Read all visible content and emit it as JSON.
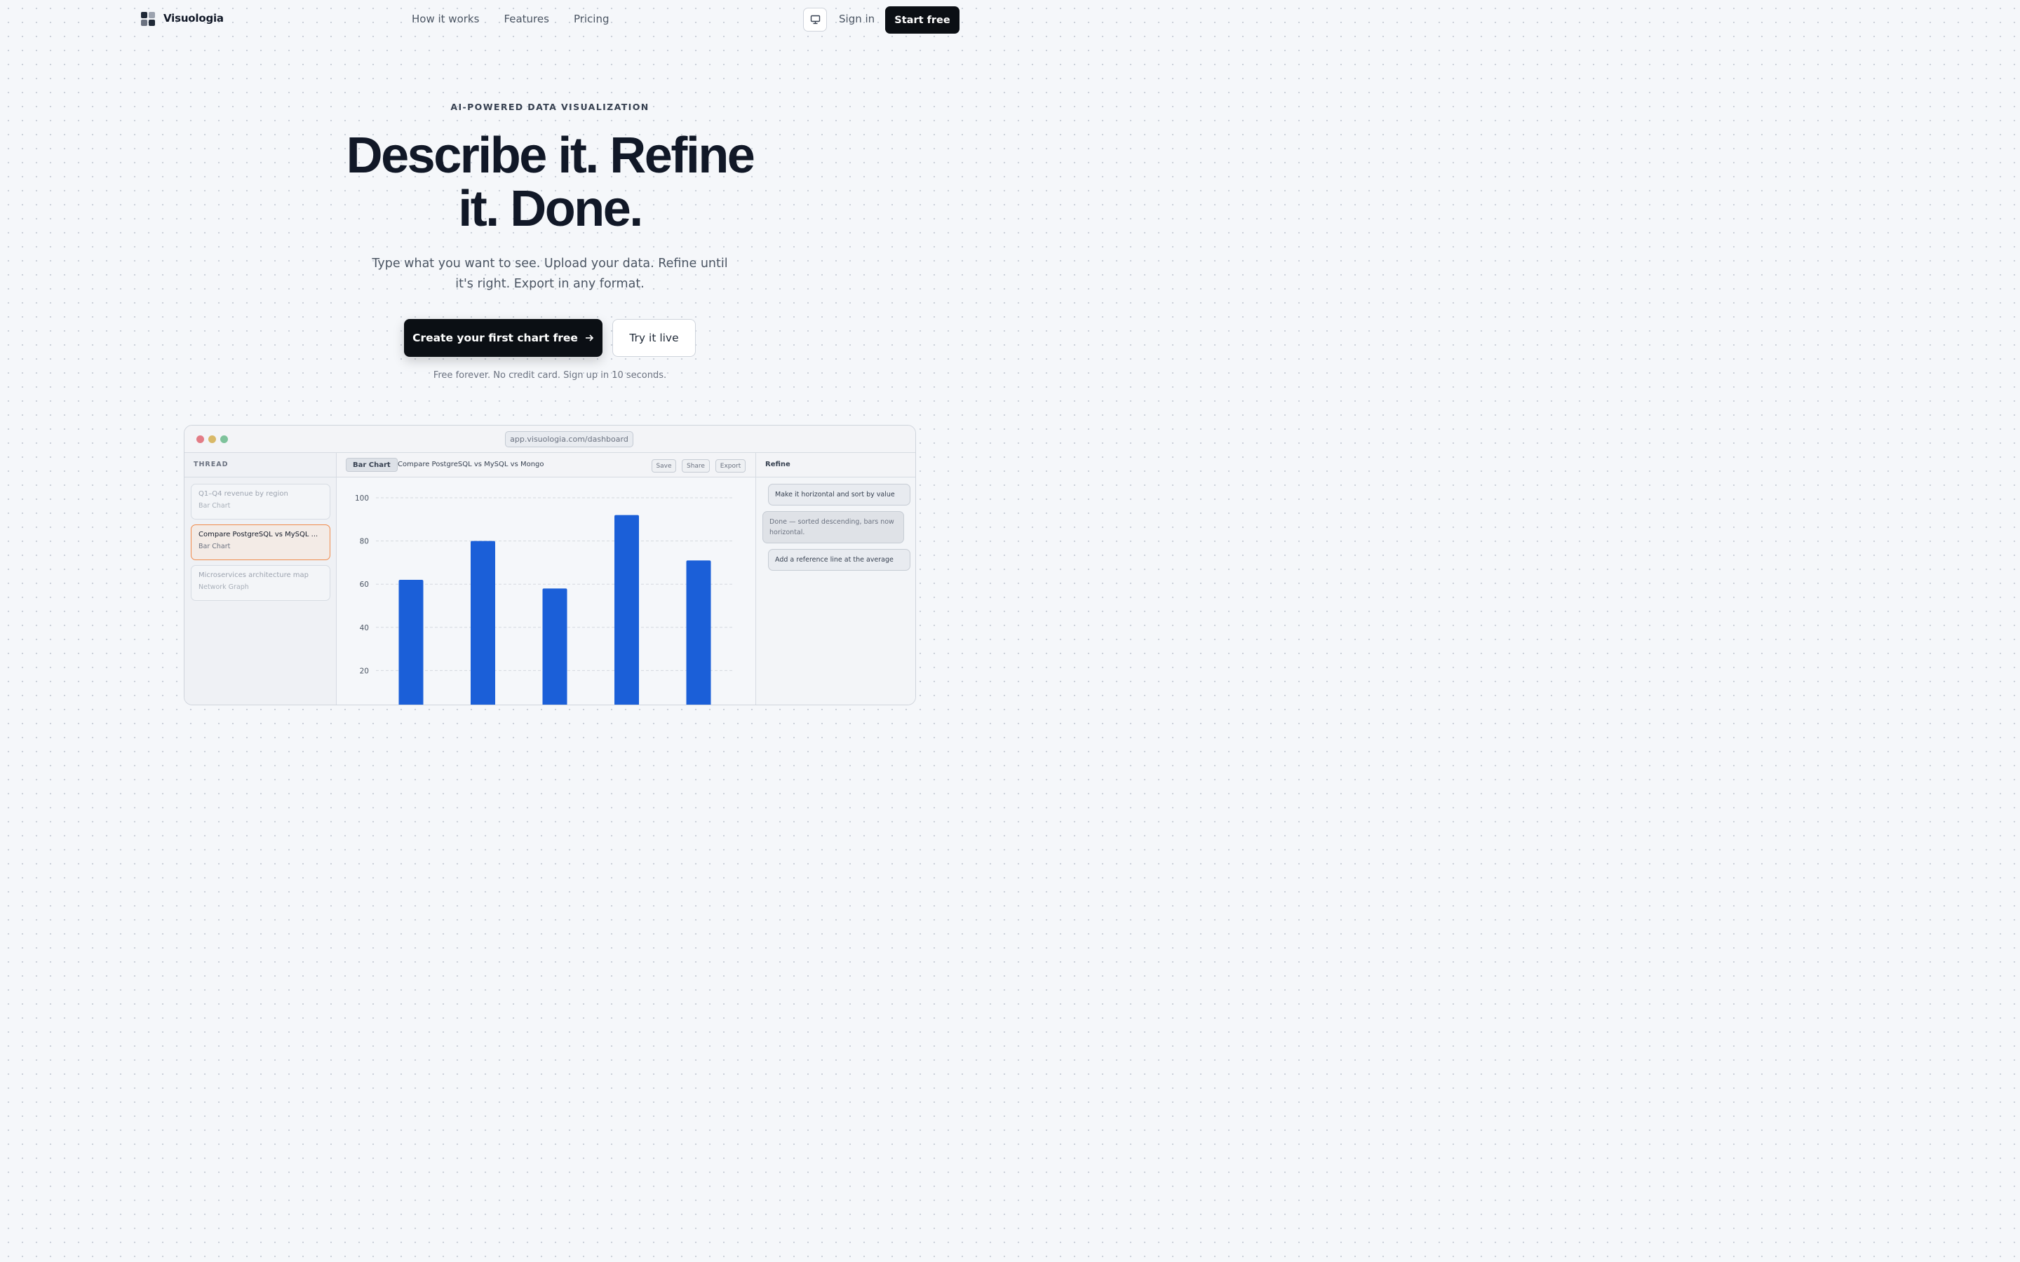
{
  "nav": {
    "brand": "Visuologia",
    "links": [
      "How it works",
      "Features",
      "Pricing"
    ],
    "theme_icon": "monitor-icon",
    "sign_in": "Sign in",
    "start_free": "Start free"
  },
  "hero": {
    "eyebrow": "AI-POWERED DATA VISUALIZATION",
    "headline_line1": "Describe it. Refine",
    "headline_line2": "it. Done.",
    "subhead": "Type what you want to see. Upload your data. Refine until it's right. Export in any format.",
    "cta_primary": "Create your first chart free",
    "cta_secondary": "Try it live",
    "footnote": "Free forever. No credit card. Sign up in 10 seconds."
  },
  "app": {
    "url": "app.visuologia.com/dashboard",
    "thread": {
      "heading": "THREAD",
      "items": [
        {
          "title": "Q1–Q4 revenue by region",
          "type": "Bar Chart",
          "active": false
        },
        {
          "title": "Compare PostgreSQL vs MySQL ...",
          "type": "Bar Chart",
          "active": true
        },
        {
          "title": "Microservices architecture map",
          "type": "Network Graph",
          "active": false
        }
      ]
    },
    "main": {
      "chip": "Bar Chart",
      "title": "Compare PostgreSQL vs MySQL vs Mongo",
      "buttons": {
        "save": "Save",
        "share": "Share",
        "export": "Export"
      }
    },
    "refine": {
      "heading": "Refine",
      "messages": [
        {
          "role": "user",
          "text": "Make it horizontal and sort by value"
        },
        {
          "role": "assistant",
          "text": "Done — sorted descending, bars now horizontal."
        },
        {
          "role": "user",
          "text": "Add a reference line at the average"
        }
      ]
    }
  },
  "chart_data": {
    "type": "bar",
    "values": [
      62,
      80,
      58,
      92,
      71
    ],
    "yticks": [
      20,
      40,
      60,
      80,
      100
    ],
    "ylim": [
      0,
      100
    ],
    "bar_color": "#1b5fd8",
    "grid": true
  }
}
